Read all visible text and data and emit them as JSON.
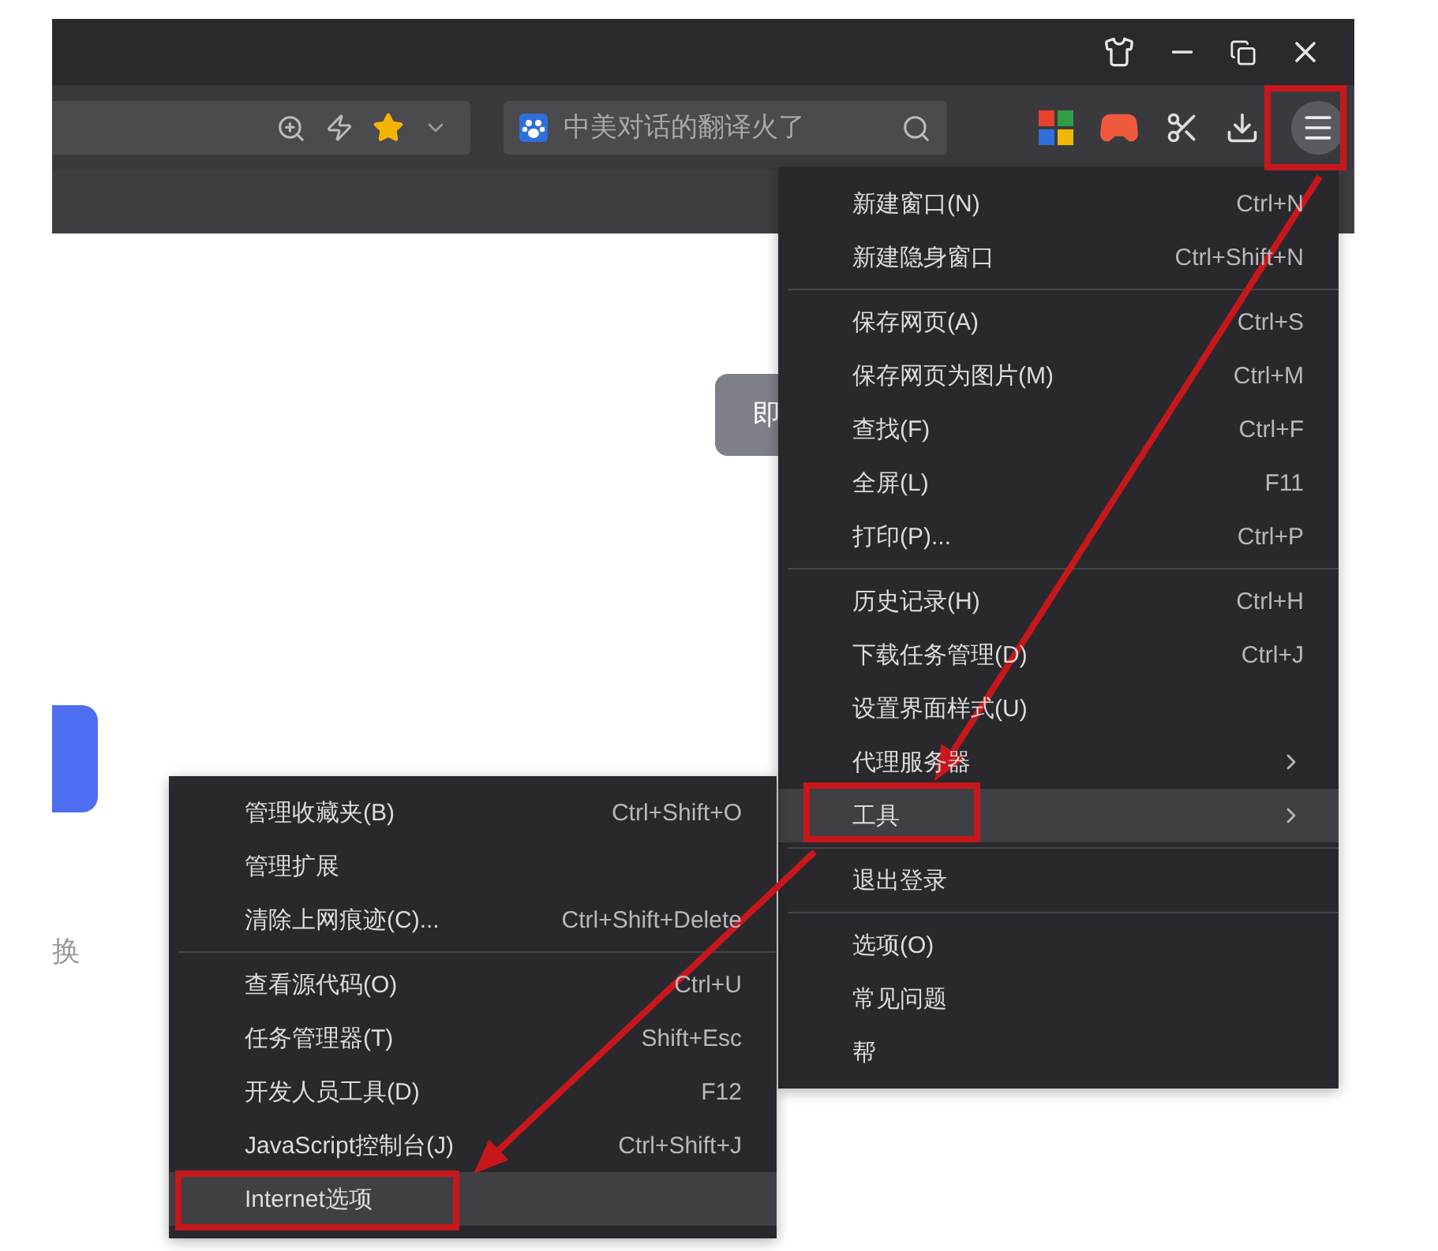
{
  "search": {
    "placeholder": "中美对话的翻译火了"
  },
  "toolbar": {
    "favorite": true
  },
  "page": {
    "button_text": "即",
    "side_text": "换"
  },
  "main_menu": {
    "items": [
      {
        "kind": "item",
        "label": "新建窗口(N)",
        "shortcut": "Ctrl+N",
        "submenu": false,
        "selected": false
      },
      {
        "kind": "item",
        "label": "新建隐身窗口",
        "shortcut": "Ctrl+Shift+N",
        "submenu": false,
        "selected": false
      },
      {
        "kind": "separator"
      },
      {
        "kind": "item",
        "label": "保存网页(A)",
        "shortcut": "Ctrl+S",
        "submenu": false,
        "selected": false
      },
      {
        "kind": "item",
        "label": "保存网页为图片(M)",
        "shortcut": "Ctrl+M",
        "submenu": false,
        "selected": false
      },
      {
        "kind": "item",
        "label": "查找(F)",
        "shortcut": "Ctrl+F",
        "submenu": false,
        "selected": false
      },
      {
        "kind": "item",
        "label": "全屏(L)",
        "shortcut": "F11",
        "submenu": false,
        "selected": false
      },
      {
        "kind": "item",
        "label": "打印(P)...",
        "shortcut": "Ctrl+P",
        "submenu": false,
        "selected": false
      },
      {
        "kind": "separator"
      },
      {
        "kind": "item",
        "label": "历史记录(H)",
        "shortcut": "Ctrl+H",
        "submenu": false,
        "selected": false
      },
      {
        "kind": "item",
        "label": "下载任务管理(D)",
        "shortcut": "Ctrl+J",
        "submenu": false,
        "selected": false
      },
      {
        "kind": "item",
        "label": "设置界面样式(U)",
        "submenu": false,
        "selected": false
      },
      {
        "kind": "item",
        "label": "代理服务器",
        "submenu": true,
        "selected": false
      },
      {
        "kind": "item",
        "label": "工具",
        "submenu": true,
        "selected": true
      },
      {
        "kind": "separator"
      },
      {
        "kind": "item",
        "label": "退出登录",
        "submenu": false,
        "selected": false
      },
      {
        "kind": "separator"
      },
      {
        "kind": "item",
        "label": "选项(O)",
        "submenu": false,
        "selected": false
      },
      {
        "kind": "item",
        "label": "常见问题",
        "submenu": false,
        "selected": false
      },
      {
        "kind": "item",
        "label": "帮",
        "submenu": false,
        "selected": false
      }
    ]
  },
  "tools_submenu": {
    "items": [
      {
        "kind": "item",
        "label": "管理收藏夹(B)",
        "shortcut": "Ctrl+Shift+O",
        "selected": false
      },
      {
        "kind": "item",
        "label": "管理扩展",
        "selected": false
      },
      {
        "kind": "item",
        "label": "清除上网痕迹(C)...",
        "shortcut": "Ctrl+Shift+Delete",
        "selected": false
      },
      {
        "kind": "separator"
      },
      {
        "kind": "item",
        "label": "查看源代码(O)",
        "shortcut": "Ctrl+U",
        "selected": false
      },
      {
        "kind": "item",
        "label": "任务管理器(T)",
        "shortcut": "Shift+Esc",
        "selected": false
      },
      {
        "kind": "item",
        "label": "开发人员工具(D)",
        "shortcut": "F12",
        "selected": false
      },
      {
        "kind": "item",
        "label": "JavaScript控制台(J)",
        "shortcut": "Ctrl+Shift+J",
        "selected": false
      },
      {
        "kind": "item",
        "label": "Internet选项",
        "selected": true
      }
    ]
  }
}
